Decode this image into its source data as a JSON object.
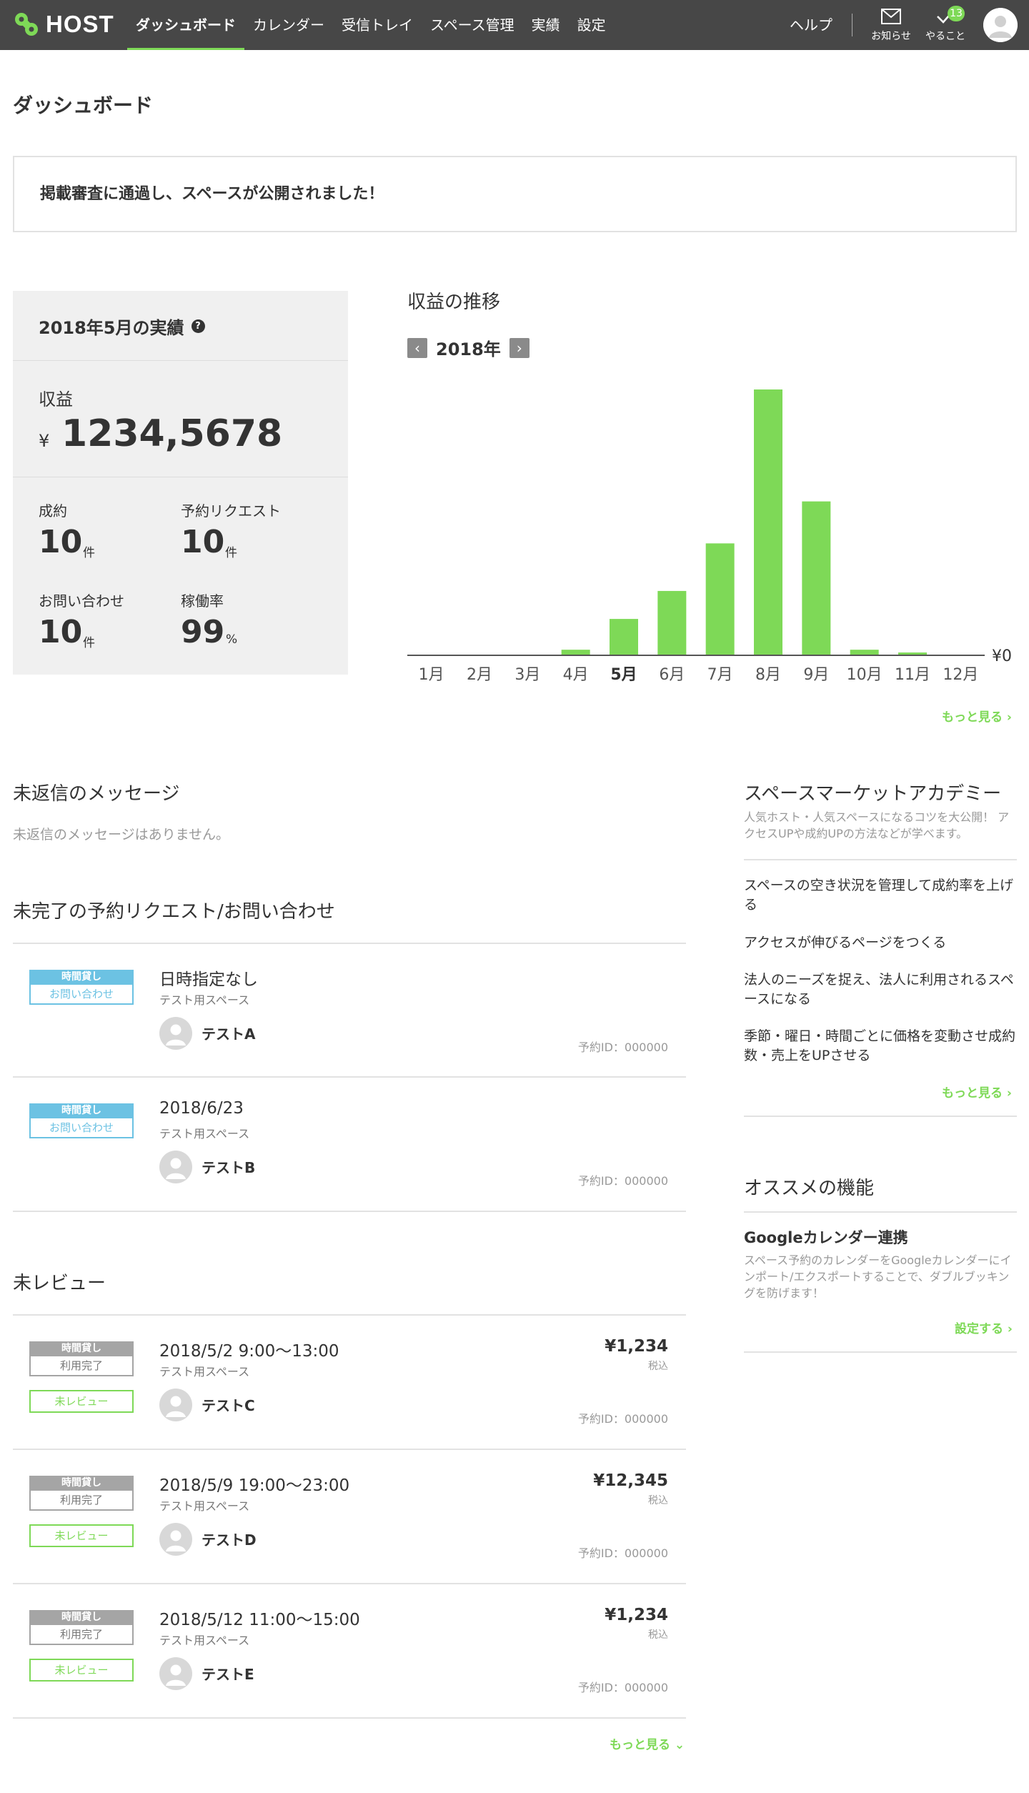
{
  "header": {
    "logo_text": "HOST",
    "nav": [
      "ダッシュボード",
      "カレンダー",
      "受信トレイ",
      "スペース管理",
      "実績",
      "設定"
    ],
    "help": "ヘルプ",
    "notifications_label": "お知らせ",
    "todo_label": "やること",
    "todo_count": "13"
  },
  "page_title": "ダッシュボード",
  "notice": "掲載審査に通過し、スペースが公開されました！",
  "monthly": {
    "title": "2018年5月の実績",
    "revenue_label": "収益",
    "currency": "¥",
    "revenue_value": "1234,5678",
    "stats": [
      {
        "label": "成約",
        "value": "10",
        "unit": "件"
      },
      {
        "label": "予約リクエスト",
        "value": "10",
        "unit": "件"
      },
      {
        "label": "お問い合わせ",
        "value": "10",
        "unit": "件"
      },
      {
        "label": "稼働率",
        "value": "99",
        "unit": "%"
      }
    ]
  },
  "revenue_chart": {
    "title": "収益の推移",
    "year": "2018年",
    "more": "もっと見る"
  },
  "chart_data": {
    "type": "bar",
    "categories": [
      "1月",
      "2月",
      "3月",
      "4月",
      "5月",
      "6月",
      "7月",
      "8月",
      "9月",
      "10月",
      "11月",
      "12月"
    ],
    "values": [
      0,
      0,
      0,
      2,
      13,
      23,
      40,
      95,
      55,
      2,
      1,
      0
    ],
    "highlight_category": "5月",
    "baseline_label": "¥0",
    "bar_color": "#7ed957"
  },
  "messages": {
    "title": "未返信のメッセージ",
    "empty": "未返信のメッセージはありません。"
  },
  "requests": {
    "title": "未完了の予約リクエスト/お問い合わせ",
    "items": [
      {
        "tag_top": "時間貸し",
        "tag_bottom": "お問い合わせ",
        "title": "日時指定なし",
        "space": "テスト用スペース",
        "user": "テストA",
        "id": "予約ID：000000"
      },
      {
        "tag_top": "時間貸し",
        "tag_bottom": "お問い合わせ",
        "title": "2018/6/23",
        "space": "テスト用スペース",
        "user": "テストB",
        "id": "予約ID：000000"
      }
    ]
  },
  "reviews": {
    "title": "未レビュー",
    "items": [
      {
        "tag_top": "時間貸し",
        "tag_bottom": "利用完了",
        "review": "未レビュー",
        "title": "2018/5/2 9:00〜13:00",
        "space": "テスト用スペース",
        "user": "テストC",
        "price": "¥1,234",
        "tax": "税込",
        "id": "予約ID：000000"
      },
      {
        "tag_top": "時間貸し",
        "tag_bottom": "利用完了",
        "review": "未レビュー",
        "title": "2018/5/9 19:00〜23:00",
        "space": "テスト用スペース",
        "user": "テストD",
        "price": "¥12,345",
        "tax": "税込",
        "id": "予約ID：000000"
      },
      {
        "tag_top": "時間貸し",
        "tag_bottom": "利用完了",
        "review": "未レビュー",
        "title": "2018/5/12 11:00〜15:00",
        "space": "テスト用スペース",
        "user": "テストE",
        "price": "¥1,234",
        "tax": "税込",
        "id": "予約ID：000000"
      }
    ],
    "more": "もっと見る"
  },
  "academy": {
    "title": "スペースマーケットアカデミー",
    "desc": "人気ホスト・人気スペースになるコツを大公開！ アクセスUPや成約UPの方法などが学べます。",
    "links": [
      "スペースの空き状況を管理して成約率を上げる",
      "アクセスが伸びるページをつくる",
      "法人のニーズを捉え、法人に利用されるスペースになる",
      "季節・曜日・時間ごとに価格を変動させ成約数・売上をUPさせる"
    ],
    "more": "もっと見る"
  },
  "features": {
    "title": "オススメの機能",
    "name": "Googleカレンダー連携",
    "desc": "スペース予約のカレンダーをGoogleカレンダーにインポート/エクスポートすることで、ダブルブッキングを防げます！",
    "action": "設定する"
  }
}
